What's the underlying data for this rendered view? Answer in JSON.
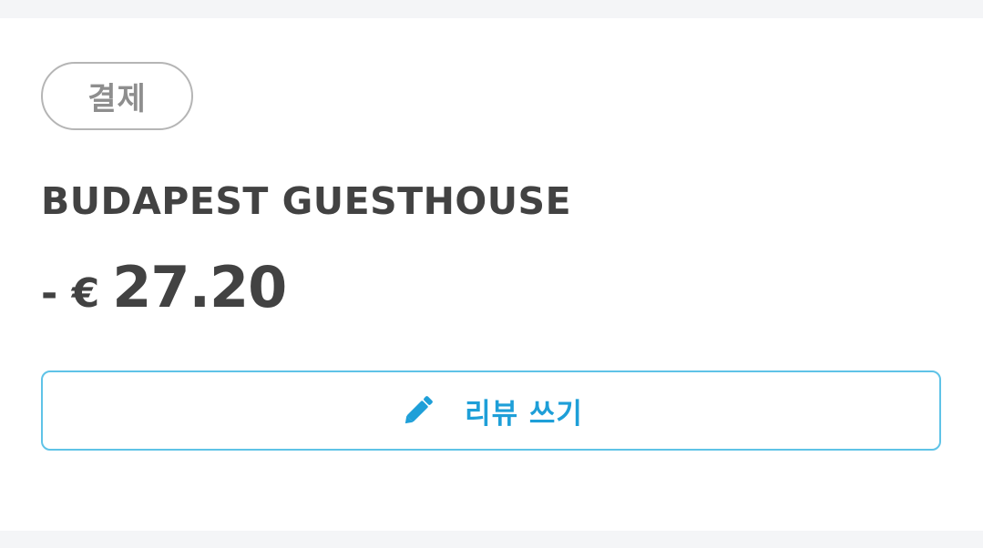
{
  "transaction": {
    "status_badge": "결제",
    "merchant_name": "BUDAPEST GUESTHOUSE",
    "amount_prefix": "- €",
    "amount_value": "27.20"
  },
  "actions": {
    "review_button_label": "리뷰 쓰기",
    "review_button_icon": "pencil-icon"
  },
  "colors": {
    "text_primary": "#424242",
    "badge_text": "#8e8e8e",
    "badge_border": "#b5b5b5",
    "accent": "#1e9fd8",
    "button_border": "#5fc3e7",
    "page_background": "#f4f5f7",
    "card_background": "#ffffff"
  }
}
